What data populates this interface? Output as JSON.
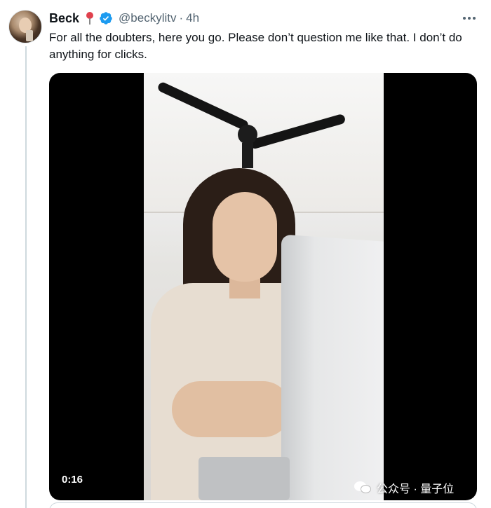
{
  "tweet": {
    "author_name": "Beck",
    "author_handle": "@beckylitv",
    "separator": "·",
    "timestamp": "4h",
    "text": "For all the doubters, here you go. Please don’t question me like that. I don’t do anything for clicks.",
    "name_emoji_icon": "pushpin-icon",
    "verified_icon": "verified-badge-icon",
    "verified_color": "#1d9bf0"
  },
  "media": {
    "type": "video",
    "duration": "0:16"
  },
  "watermark": {
    "text": "公众号 · 量子位",
    "icon": "wechat-icon"
  },
  "colors": {
    "text_primary": "#0f1419",
    "text_secondary": "#536471",
    "border": "#cfd9de"
  }
}
